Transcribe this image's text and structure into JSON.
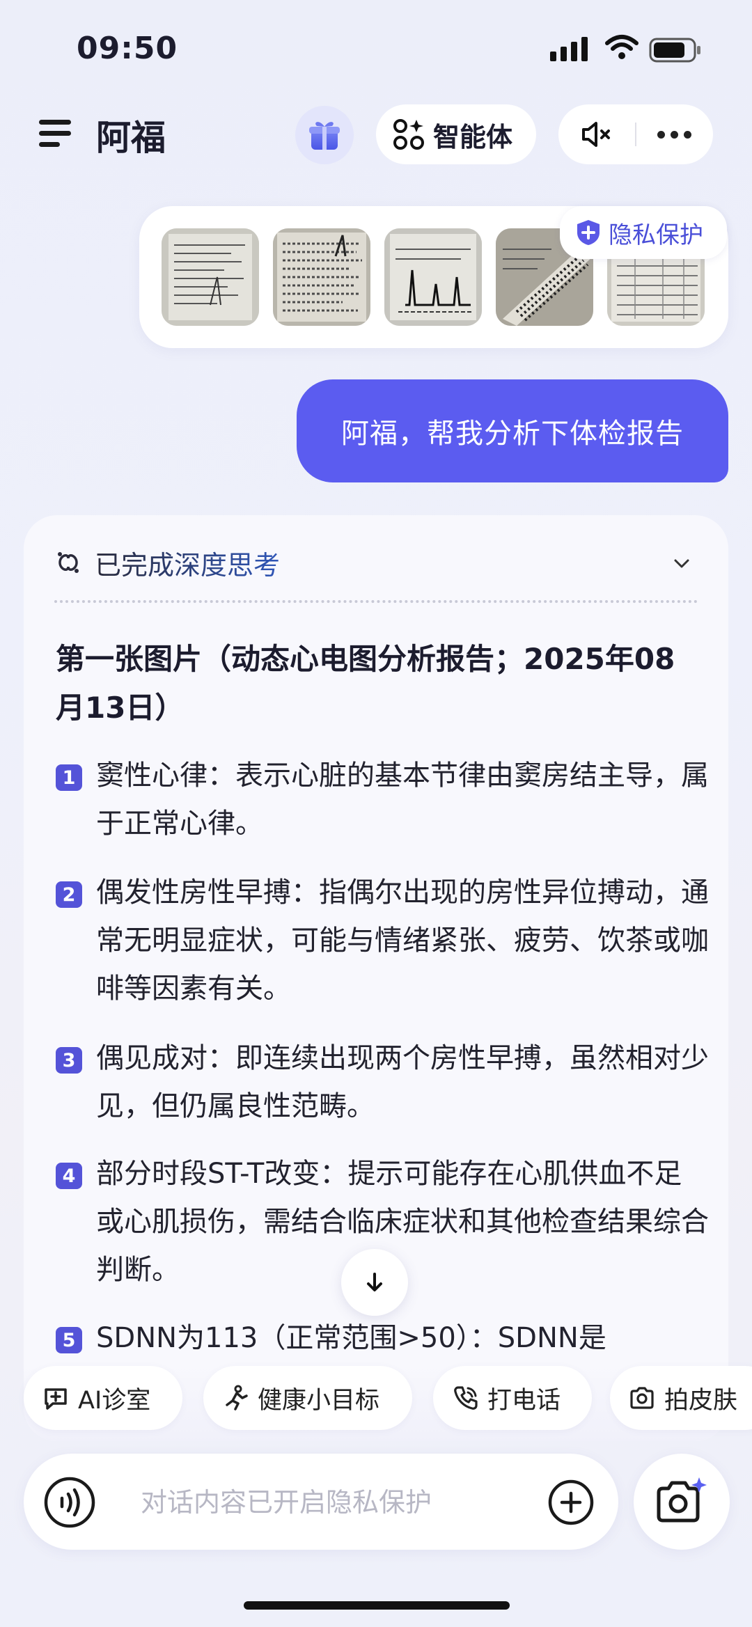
{
  "status_bar": {
    "time": "09:50"
  },
  "header": {
    "title": "阿福",
    "agent_label": "智能体",
    "icons": [
      "menu-icon",
      "gift-icon",
      "agent-grid-icon",
      "mute-icon",
      "more-icon"
    ]
  },
  "images": {
    "privacy_label": "隐私保护",
    "thumbnail_count": 5
  },
  "user_message": "阿福，帮我分析下体检报告",
  "answer": {
    "thinking_label": "已完成深度思考",
    "heading": "第一张图片（动态心电图分析报告；2025年08月13日）",
    "items": [
      {
        "num": "1",
        "text": "窦性心律：表示心脏的基本节律由窦房结主导，属于正常心律。"
      },
      {
        "num": "2",
        "text": "偶发性房性早搏：指偶尔出现的房性异位搏动，通常无明显症状，可能与情绪紧张、疲劳、饮茶或咖啡等因素有关。"
      },
      {
        "num": "3",
        "text": "偶见成对：即连续出现两个房性早搏，虽然相对少见，但仍属良性范畴。"
      },
      {
        "num": "4",
        "text": "部分时段ST-T改变：提示可能存在心肌供血不足或心肌损伤，需结合临床症状和其他检查结果综合判断。"
      },
      {
        "num": "5",
        "text": "SDNN为113（正常范围>50）：SDNN是"
      }
    ]
  },
  "chips": [
    {
      "label": "AI诊室",
      "icon": "chat-plus-icon"
    },
    {
      "label": "健康小目标",
      "icon": "run-icon"
    },
    {
      "label": "打电话",
      "icon": "phone-icon"
    },
    {
      "label": "拍皮肤",
      "icon": "camera-icon"
    }
  ],
  "input": {
    "placeholder": "对话内容已开启隐私保护"
  },
  "colors": {
    "accent": "#5B5CF0",
    "badge": "#5453D8",
    "thinking_blue": "#2F56B8"
  }
}
